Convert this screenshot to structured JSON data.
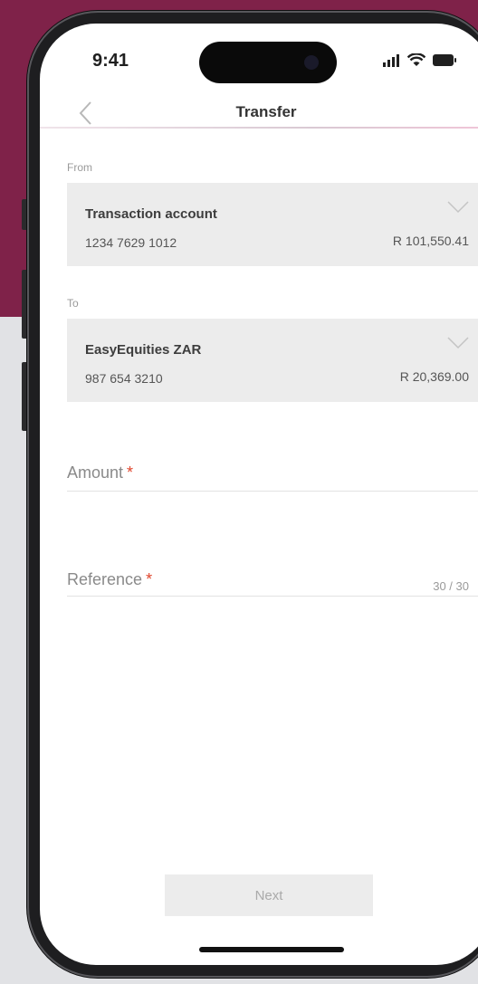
{
  "status_bar": {
    "time": "9:41",
    "icons": [
      "signal-icon",
      "wifi-icon",
      "battery-icon"
    ]
  },
  "nav": {
    "title": "Transfer",
    "back_icon": "chevron-left-icon"
  },
  "from": {
    "label": "From",
    "account_name": "Transaction account",
    "account_number": "1234 7629 1012",
    "balance": "R 101,550.41",
    "expand_icon": "chevron-down-icon"
  },
  "to": {
    "label": "To",
    "account_name": "EasyEquities ZAR",
    "account_number": "987 654 3210",
    "balance": "R 20,369.00",
    "expand_icon": "chevron-down-icon"
  },
  "amount": {
    "label": "Amount",
    "required_marker": "*",
    "value": ""
  },
  "reference": {
    "label": "Reference",
    "required_marker": "*",
    "value": "",
    "counter": "30 / 30"
  },
  "next_button": {
    "label": "Next"
  },
  "colors": {
    "brand_background": "#7f2249",
    "required": "#e0452c",
    "card_background": "#ececec"
  }
}
